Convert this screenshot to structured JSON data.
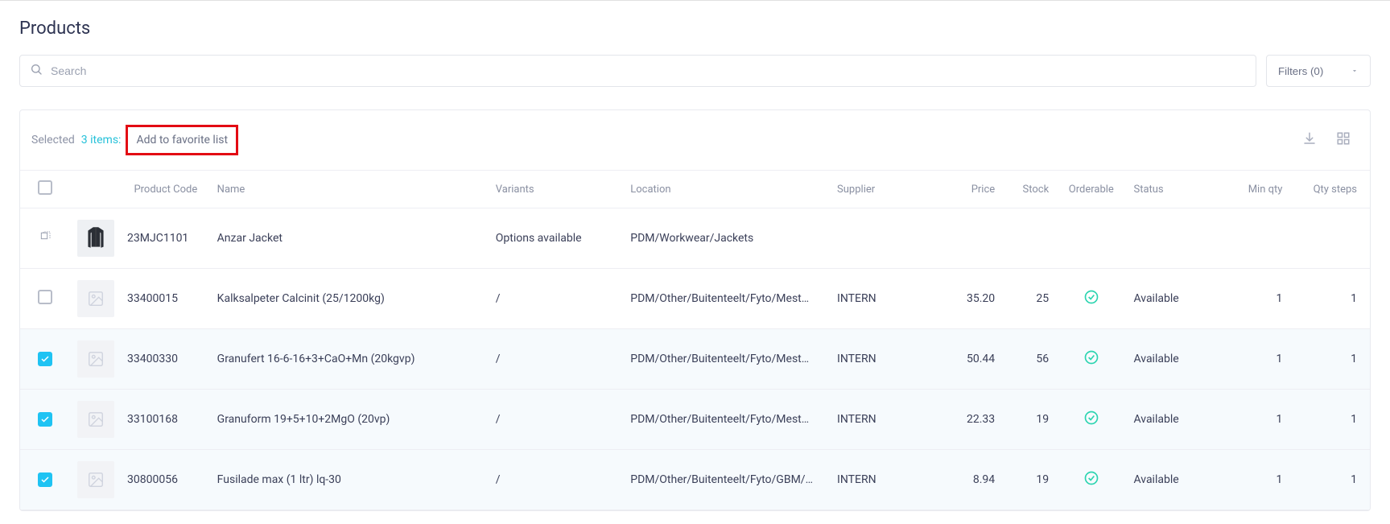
{
  "page_title": "Products",
  "search": {
    "placeholder": "Search"
  },
  "filters": {
    "label": "Filters (0)"
  },
  "selection": {
    "prefix": "Selected ",
    "items_text": "3 items:",
    "favorite_label": "Add to favorite list"
  },
  "columns": {
    "code": "Product Code",
    "name": "Name",
    "variants": "Variants",
    "location": "Location",
    "supplier": "Supplier",
    "price": "Price",
    "stock": "Stock",
    "orderable": "Orderable",
    "status": "Status",
    "min_qty": "Min qty",
    "qty_steps": "Qty steps"
  },
  "rows": [
    {
      "selected": "expand",
      "thumb": "jacket",
      "code": "23MJC1101",
      "name": "Anzar Jacket",
      "variants": "Options available",
      "location": "PDM/Workwear/Jackets",
      "supplier": "",
      "price": "",
      "stock": "",
      "orderable": "",
      "status": "",
      "min_qty": "",
      "qty_steps": ""
    },
    {
      "selected": "false",
      "thumb": "placeholder",
      "code": "33400015",
      "name": "Kalksalpeter Calcinit (25/1200kg)",
      "variants": "/",
      "location": "PDM/Other/Buitenteelt/Fyto/Mest…",
      "supplier": "INTERN",
      "price": "35.20",
      "stock": "25",
      "orderable": "yes",
      "status": "Available",
      "min_qty": "1",
      "qty_steps": "1"
    },
    {
      "selected": "true",
      "thumb": "placeholder",
      "code": "33400330",
      "name": "Granufert 16-6-16+3+CaO+Mn (20kgvp)",
      "variants": "/",
      "location": "PDM/Other/Buitenteelt/Fyto/Mest…",
      "supplier": "INTERN",
      "price": "50.44",
      "stock": "56",
      "orderable": "yes",
      "status": "Available",
      "min_qty": "1",
      "qty_steps": "1"
    },
    {
      "selected": "true",
      "thumb": "placeholder",
      "code": "33100168",
      "name": "Granuform 19+5+10+2MgO (20vp)",
      "variants": "/",
      "location": "PDM/Other/Buitenteelt/Fyto/Mest…",
      "supplier": "INTERN",
      "price": "22.33",
      "stock": "19",
      "orderable": "yes",
      "status": "Available",
      "min_qty": "1",
      "qty_steps": "1"
    },
    {
      "selected": "true",
      "thumb": "placeholder",
      "code": "30800056",
      "name": "Fusilade max (1 ltr) lq-30",
      "variants": "/",
      "location": "PDM/Other/Buitenteelt/Fyto/GBM/…",
      "supplier": "INTERN",
      "price": "8.94",
      "stock": "19",
      "orderable": "yes",
      "status": "Available",
      "min_qty": "1",
      "qty_steps": "1"
    }
  ]
}
